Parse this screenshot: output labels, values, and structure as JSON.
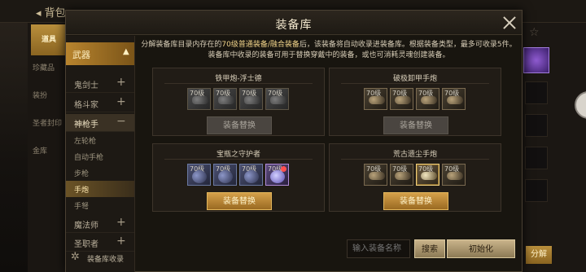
{
  "background": {
    "back_label": "◂ 背包",
    "side_active": "道具",
    "side_items": [
      "珍藏品",
      "装扮",
      "圣者封印",
      "金库"
    ],
    "right_button": "分解"
  },
  "modal": {
    "title": "装备库",
    "description_line1_pre": "分解装备库目录内存在的",
    "description_line1_hl": "70级普通装备/融合装备",
    "description_line1_post": "后，该装备将自动收录进装备库。根据装备类型，最多可收录5件。",
    "description_line2": "装备库中收录的装备可用于替换穿戴中的装备，或也可消耗灵魂创建装备。"
  },
  "sidebar": {
    "category": "武器",
    "classes": [
      {
        "label": "鬼剑士",
        "sign": "+"
      },
      {
        "label": "格斗家",
        "sign": "+"
      },
      {
        "label": "神枪手",
        "sign": "−"
      },
      {
        "label": "魔法师",
        "sign": "+"
      },
      {
        "label": "圣职者",
        "sign": "+"
      }
    ],
    "subtypes": [
      "左轮枪",
      "自动手枪",
      "步枪",
      "手炮",
      "手弩"
    ],
    "selected_subtype": "手炮",
    "collect_label": "装备库收录"
  },
  "slots": [
    {
      "name": "铁甲炮-浮士德",
      "items": [
        "70级",
        "70级",
        "70级",
        "70级"
      ],
      "button": "装备替换",
      "enabled": false
    },
    {
      "name": "破极卸甲手炮",
      "items": [
        "70级",
        "70级",
        "70级",
        "70级"
      ],
      "button": "装备替换",
      "enabled": false
    },
    {
      "name": "宝瓶之守护者",
      "items": [
        "70级",
        "70级",
        "70级",
        "70级"
      ],
      "button": "装备替换",
      "enabled": true
    },
    {
      "name": "荒古遗尘手炮",
      "items": [
        "70级",
        "70级",
        "70级",
        "70级"
      ],
      "button": "装备替换",
      "enabled": true
    }
  ],
  "footer": {
    "search_placeholder": "输入装备名称",
    "search_button": "搜索",
    "reset_button": "初始化"
  }
}
